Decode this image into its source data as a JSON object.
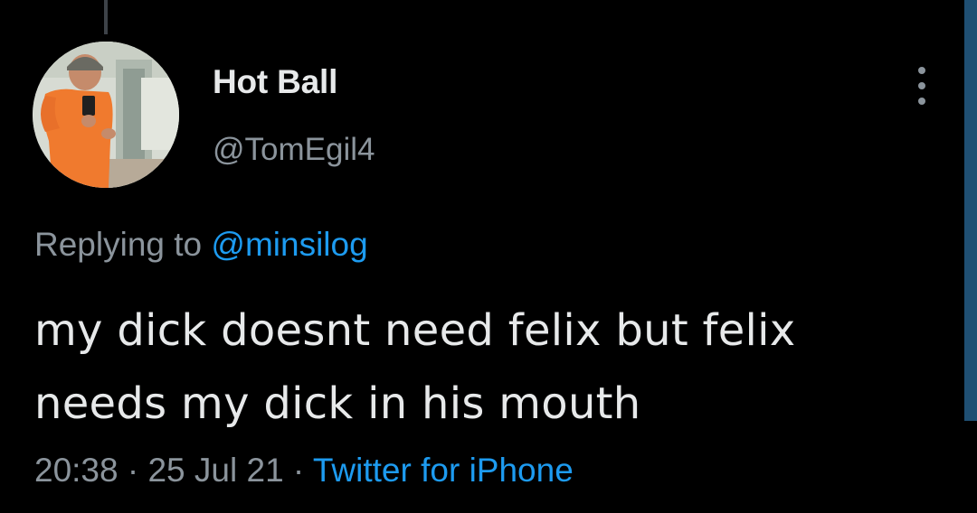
{
  "tweet": {
    "display_name": "Hot Ball",
    "handle": "@TomEgil4",
    "replying_prefix": "Replying to ",
    "replying_to": "@minsilog",
    "text_line1": "my dick doesnt need felix but felix",
    "text_line2": "needs my dick in his mouth",
    "time": "20:38",
    "separator": " · ",
    "date": "25 Jul 21",
    "source": "Twitter for iPhone"
  },
  "icons": {
    "more": "more-vertical-icon",
    "avatar": "profile-photo"
  },
  "colors": {
    "background": "#000000",
    "primary_text": "#e7e9ea",
    "secondary_text": "#8b949c",
    "accent": "#1d9bf0"
  }
}
